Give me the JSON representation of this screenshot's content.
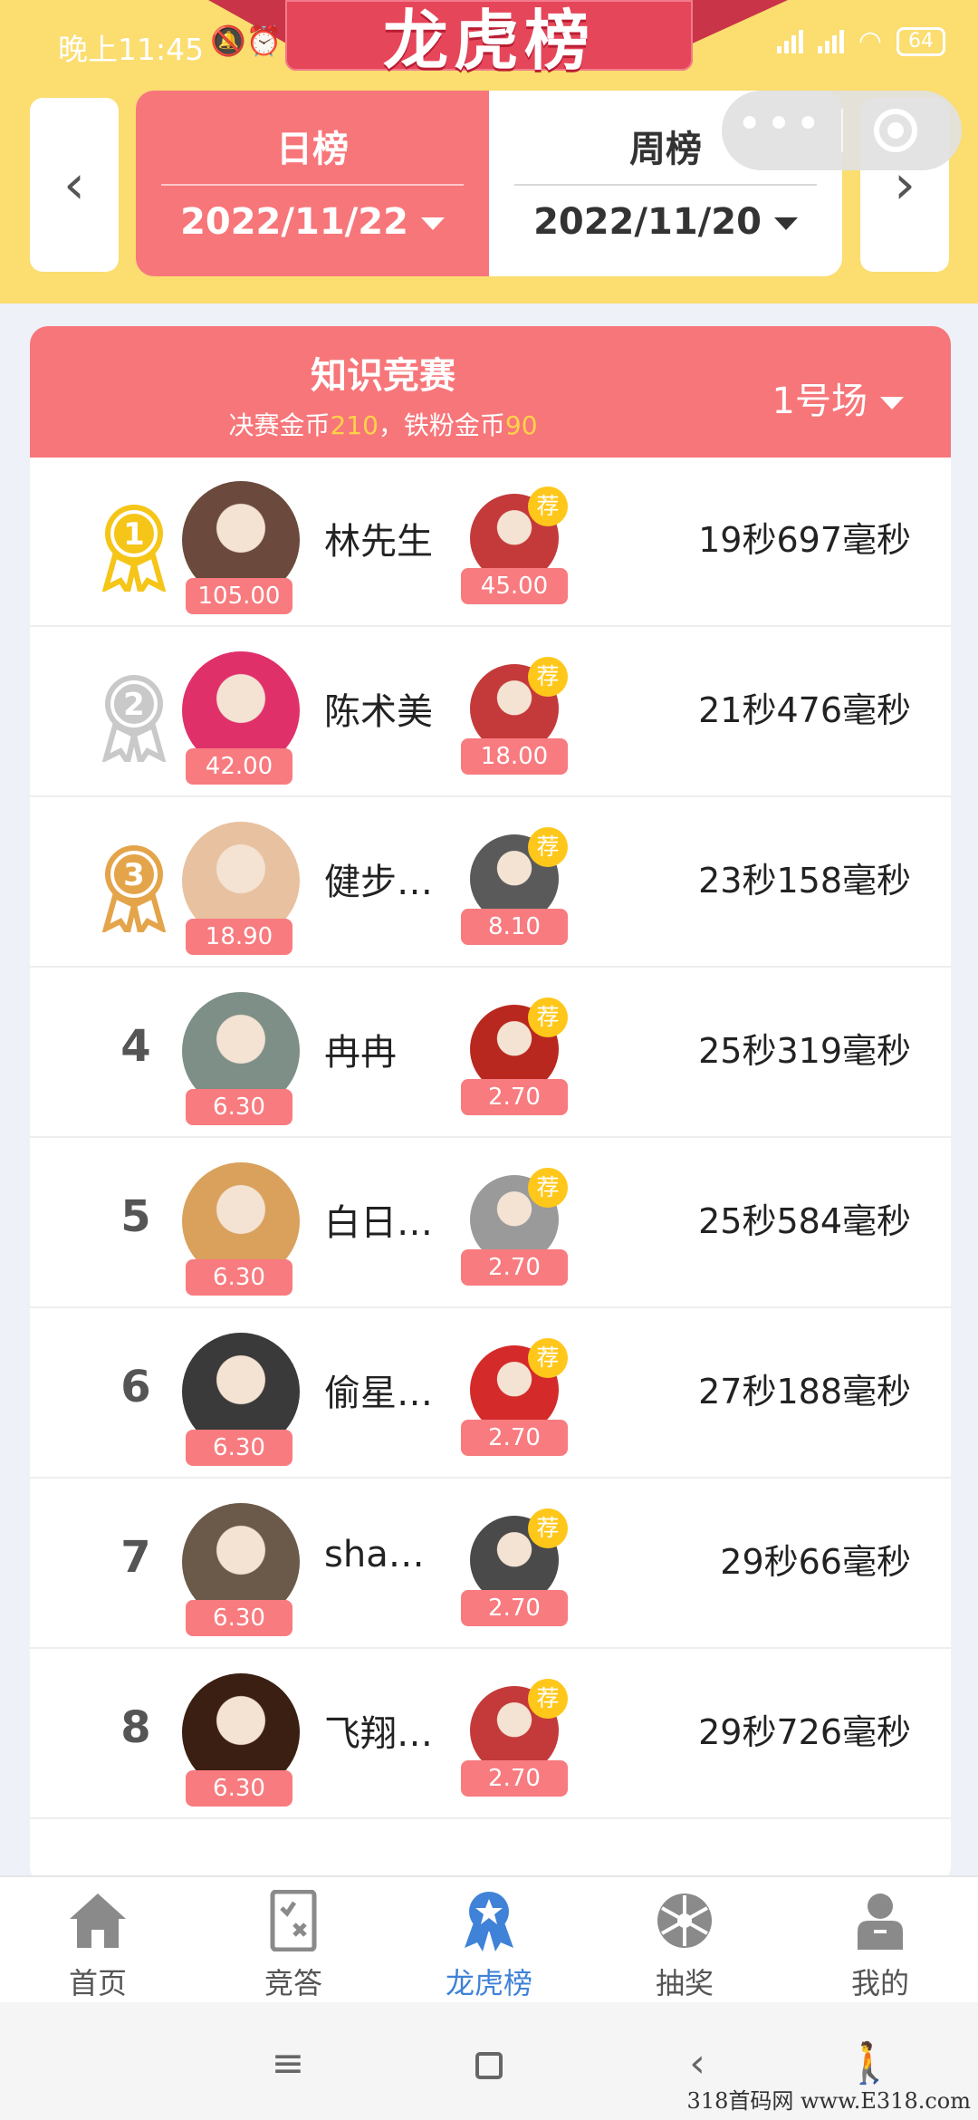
{
  "status_bar": {
    "time": "晚上11:45",
    "battery": "64"
  },
  "banner": {
    "title": "龙虎榜"
  },
  "tabs": [
    {
      "label": "日榜",
      "date": "2022/11/22",
      "active": true
    },
    {
      "label": "周榜",
      "date": "2022/11/20",
      "active": false
    }
  ],
  "card": {
    "title": "知识竞赛",
    "subtitle_prefix": "决赛金币",
    "final_coins": "210",
    "subtitle_mid": "，铁粉金币",
    "fan_coins": "90",
    "room": "1号场"
  },
  "rows": [
    {
      "rank": "1",
      "name": "林先生",
      "user_amount": "105.00",
      "ref_amount": "45.00",
      "time": "19秒697毫秒"
    },
    {
      "rank": "2",
      "name": "陈术美",
      "user_amount": "42.00",
      "ref_amount": "18.00",
      "time": "21秒476毫秒"
    },
    {
      "rank": "3",
      "name": "健步…",
      "user_amount": "18.90",
      "ref_amount": "8.10",
      "time": "23秒158毫秒"
    },
    {
      "rank": "4",
      "name": "冉冉",
      "user_amount": "6.30",
      "ref_amount": "2.70",
      "time": "25秒319毫秒"
    },
    {
      "rank": "5",
      "name": "白日…",
      "user_amount": "6.30",
      "ref_amount": "2.70",
      "time": "25秒584毫秒"
    },
    {
      "rank": "6",
      "name": "偷星…",
      "user_amount": "6.30",
      "ref_amount": "2.70",
      "time": "27秒188毫秒"
    },
    {
      "rank": "7",
      "name": "sha…",
      "user_amount": "6.30",
      "ref_amount": "2.70",
      "time": "29秒66毫秒"
    },
    {
      "rank": "8",
      "name": "飞翔…",
      "user_amount": "6.30",
      "ref_amount": "2.70",
      "time": "29秒726毫秒"
    }
  ],
  "recommend_badge": "荐",
  "bottom_nav": [
    {
      "label": "首页",
      "icon": "home-icon"
    },
    {
      "label": "竞答",
      "icon": "quiz-icon"
    },
    {
      "label": "龙虎榜",
      "icon": "ribbon-star-icon",
      "active": true
    },
    {
      "label": "抽奖",
      "icon": "wheel-icon"
    },
    {
      "label": "我的",
      "icon": "user-icon"
    }
  ],
  "watermark": "318首码网 www.E318.com",
  "colors": {
    "header_yellow": "#fbdd70",
    "accent_red": "#f7767a",
    "gold": "#ffd24a",
    "active_blue": "#3f82d8"
  }
}
